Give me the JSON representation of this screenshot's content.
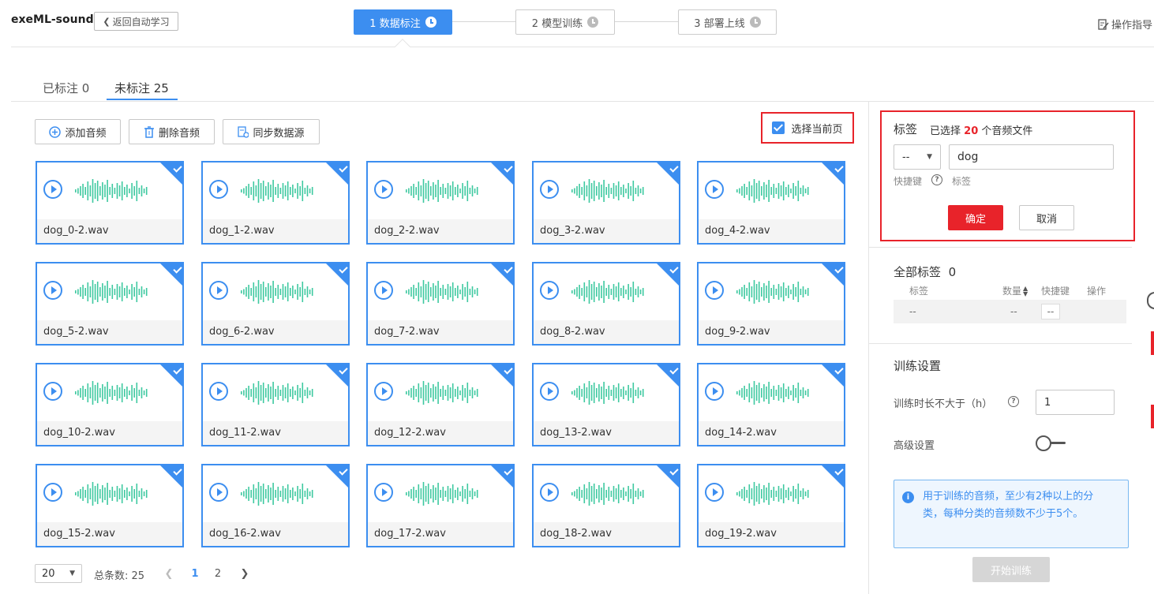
{
  "app": {
    "title": "exeML-sound",
    "back_label": "返回自动学习",
    "guide_label": "操作指导"
  },
  "steps": [
    {
      "label": "1 数据标注",
      "active": true
    },
    {
      "label": "2 模型训练",
      "active": false
    },
    {
      "label": "3 部署上线",
      "active": false
    }
  ],
  "tabs": [
    {
      "label": "已标注 0",
      "active": false
    },
    {
      "label": "未标注 25",
      "active": true
    }
  ],
  "toolbar": {
    "add_label": "添加音频",
    "delete_label": "删除音频",
    "sync_label": "同步数据源",
    "select_page_label": "选择当前页",
    "select_page_checked": true
  },
  "files": [
    "dog_0-2.wav",
    "dog_1-2.wav",
    "dog_2-2.wav",
    "dog_3-2.wav",
    "dog_4-2.wav",
    "dog_5-2.wav",
    "dog_6-2.wav",
    "dog_7-2.wav",
    "dog_8-2.wav",
    "dog_9-2.wav",
    "dog_10-2.wav",
    "dog_11-2.wav",
    "dog_12-2.wav",
    "dog_13-2.wav",
    "dog_14-2.wav",
    "dog_15-2.wav",
    "dog_16-2.wav",
    "dog_17-2.wav",
    "dog_18-2.wav",
    "dog_19-2.wav"
  ],
  "pagination": {
    "page_size": "20",
    "total_label": "总条数: 25",
    "pages": [
      "1",
      "2"
    ],
    "current": "1"
  },
  "label_panel": {
    "title": "标签",
    "selected_prefix": "已选择",
    "selected_count": "20",
    "selected_suffix": "个音频文件",
    "shortcut_value": "--",
    "label_value": "dog",
    "shortcut_hint": "快捷键",
    "label_hint": "标签",
    "confirm_label": "确定",
    "cancel_label": "取消"
  },
  "all_labels": {
    "title": "全部标签",
    "count": "0",
    "headers": {
      "label": "标签",
      "count": "数量",
      "shortcut": "快捷键",
      "action": "操作"
    },
    "row": {
      "label": "--",
      "count": "--",
      "shortcut": "--"
    }
  },
  "training": {
    "title": "训练设置",
    "duration_label": "训练时长不大于（h）",
    "duration_value": "1",
    "advanced_label": "高级设置",
    "advanced_enabled": false,
    "info_text": "用于训练的音频，至少有2种以上的分类，每种分类的音频数不少于5个。",
    "start_label": "开始训练"
  },
  "colors": {
    "primary": "#3c8ef0",
    "danger": "#e8232a",
    "wave": "#3ec9a0"
  }
}
